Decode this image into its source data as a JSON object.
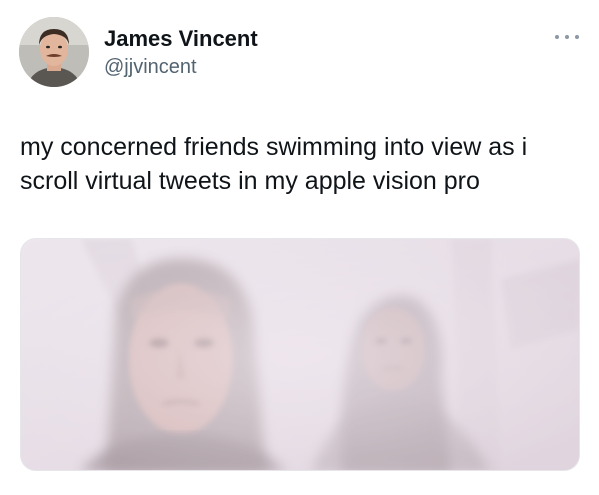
{
  "tweet": {
    "author": {
      "display_name": "James Vincent",
      "handle": "@jjvincent"
    },
    "text_lines": [
      "my concerned friends swimming into view as i",
      "scroll virtual tweets in my apple vision pro"
    ],
    "more_icon": "more-horizontal-icon",
    "media": {
      "type": "image",
      "depicts": "two faded, ghost-like figures in a misty pale pink scene"
    }
  },
  "colors": {
    "text": "#0f1419",
    "secondary_text": "#536471",
    "background": "#ffffff",
    "media_tint": "#e9e3ea"
  }
}
